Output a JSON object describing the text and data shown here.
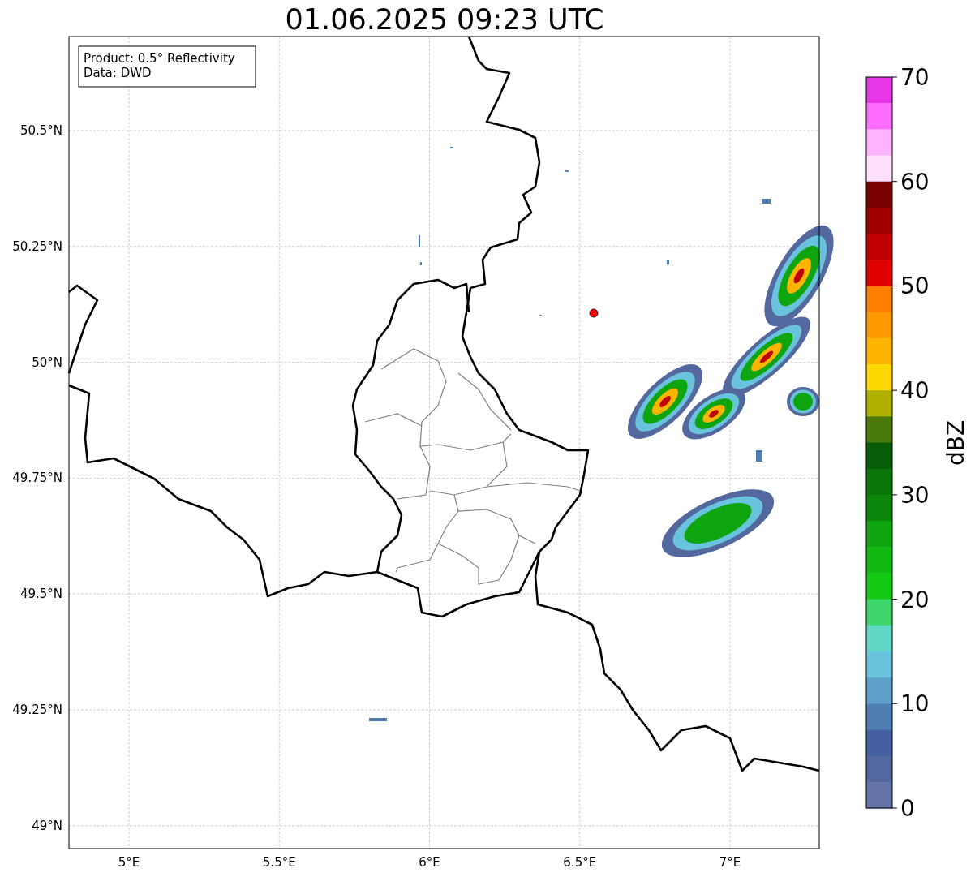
{
  "title": "01.06.2025 09:23 UTC",
  "info_box": {
    "lines": [
      "Product: 0.5° Reflectivity",
      "Data: DWD"
    ]
  },
  "map": {
    "lat_ticks": [
      "50.5°N",
      "50.25°N",
      "50°N",
      "49.75°N",
      "49.5°N",
      "49.25°N",
      "49°N"
    ],
    "lon_ticks": [
      "5°E",
      "5.5°E",
      "6°E",
      "6.5°E",
      "7°E"
    ]
  },
  "colorbar": {
    "label": "dBZ",
    "ticks": [
      "70",
      "60",
      "50",
      "40",
      "30",
      "20",
      "10",
      "0"
    ],
    "segments": [
      {
        "color": "#e936e9"
      },
      {
        "color": "#ff6cff"
      },
      {
        "color": "#ffb3ff"
      },
      {
        "color": "#ffe0ff"
      },
      {
        "color": "#780000"
      },
      {
        "color": "#a00000"
      },
      {
        "color": "#c00000"
      },
      {
        "color": "#e00000"
      },
      {
        "color": "#ff7f00"
      },
      {
        "color": "#ff9900"
      },
      {
        "color": "#ffb400"
      },
      {
        "color": "#ffd800"
      },
      {
        "color": "#b0b000"
      },
      {
        "color": "#4a7a0a"
      },
      {
        "color": "#075d07"
      },
      {
        "color": "#0a760a"
      },
      {
        "color": "#0b860b"
      },
      {
        "color": "#0fa50f"
      },
      {
        "color": "#12b812"
      },
      {
        "color": "#12c912"
      },
      {
        "color": "#3dd66a"
      },
      {
        "color": "#5fd7c4"
      },
      {
        "color": "#69c3dc"
      },
      {
        "color": "#5d9fc8"
      },
      {
        "color": "#4f7fb2"
      },
      {
        "color": "#4460a3"
      },
      {
        "color": "#5468a0"
      },
      {
        "color": "#6474a8"
      }
    ]
  }
}
